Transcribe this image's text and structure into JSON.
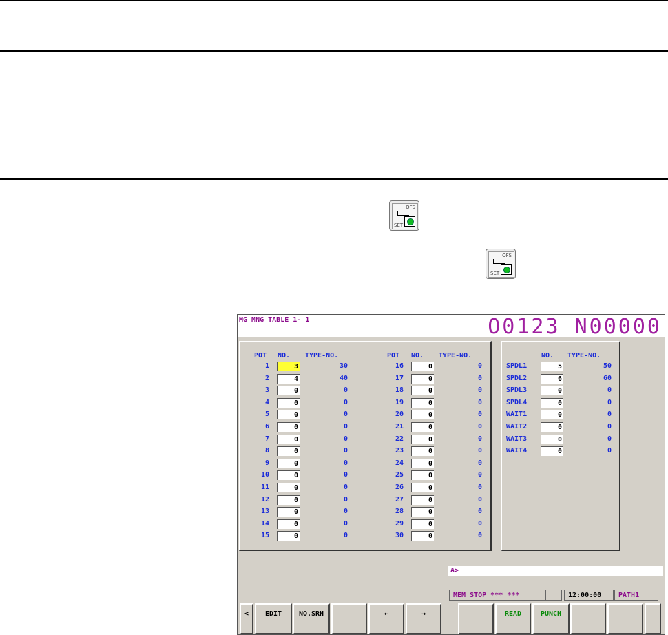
{
  "icons": [
    "ofs-set-key-icon",
    "ofs-set-key-icon"
  ],
  "screen": {
    "title": "MG MNG TABLE 1-   1",
    "program": "O0123 N00000",
    "left_headers": [
      "POT",
      "NO.",
      "TYPE-NO.",
      "POT",
      "NO.",
      "TYPE-NO."
    ],
    "pots_a": [
      {
        "pot": "1",
        "no": "3",
        "type": "30"
      },
      {
        "pot": "2",
        "no": "4",
        "type": "40"
      },
      {
        "pot": "3",
        "no": "0",
        "type": "0"
      },
      {
        "pot": "4",
        "no": "0",
        "type": "0"
      },
      {
        "pot": "5",
        "no": "0",
        "type": "0"
      },
      {
        "pot": "6",
        "no": "0",
        "type": "0"
      },
      {
        "pot": "7",
        "no": "0",
        "type": "0"
      },
      {
        "pot": "8",
        "no": "0",
        "type": "0"
      },
      {
        "pot": "9",
        "no": "0",
        "type": "0"
      },
      {
        "pot": "10",
        "no": "0",
        "type": "0"
      },
      {
        "pot": "11",
        "no": "0",
        "type": "0"
      },
      {
        "pot": "12",
        "no": "0",
        "type": "0"
      },
      {
        "pot": "13",
        "no": "0",
        "type": "0"
      },
      {
        "pot": "14",
        "no": "0",
        "type": "0"
      },
      {
        "pot": "15",
        "no": "0",
        "type": "0"
      }
    ],
    "pots_b": [
      {
        "pot": "16",
        "no": "0",
        "type": "0"
      },
      {
        "pot": "17",
        "no": "0",
        "type": "0"
      },
      {
        "pot": "18",
        "no": "0",
        "type": "0"
      },
      {
        "pot": "19",
        "no": "0",
        "type": "0"
      },
      {
        "pot": "20",
        "no": "0",
        "type": "0"
      },
      {
        "pot": "21",
        "no": "0",
        "type": "0"
      },
      {
        "pot": "22",
        "no": "0",
        "type": "0"
      },
      {
        "pot": "23",
        "no": "0",
        "type": "0"
      },
      {
        "pot": "24",
        "no": "0",
        "type": "0"
      },
      {
        "pot": "25",
        "no": "0",
        "type": "0"
      },
      {
        "pot": "26",
        "no": "0",
        "type": "0"
      },
      {
        "pot": "27",
        "no": "0",
        "type": "0"
      },
      {
        "pot": "28",
        "no": "0",
        "type": "0"
      },
      {
        "pot": "29",
        "no": "0",
        "type": "0"
      },
      {
        "pot": "30",
        "no": "0",
        "type": "0"
      }
    ],
    "right_headers": [
      "NO.",
      "TYPE-NO."
    ],
    "spindles": [
      {
        "name": "SPDL1",
        "no": "5",
        "type": "50"
      },
      {
        "name": "SPDL2",
        "no": "6",
        "type": "60"
      },
      {
        "name": "SPDL3",
        "no": "0",
        "type": "0"
      },
      {
        "name": "SPDL4",
        "no": "0",
        "type": "0"
      },
      {
        "name": "WAIT1",
        "no": "0",
        "type": "0"
      },
      {
        "name": "WAIT2",
        "no": "0",
        "type": "0"
      },
      {
        "name": "WAIT3",
        "no": "0",
        "type": "0"
      },
      {
        "name": "WAIT4",
        "no": "0",
        "type": "0"
      }
    ],
    "input_prompt": "A>",
    "status": {
      "mode": "MEM  STOP *** ***",
      "time": "12:00:00",
      "path": "PATH1"
    },
    "softkeys": [
      "<",
      "EDIT",
      "NO.SRH",
      "",
      "←",
      "→",
      "",
      "READ",
      "PUNCH",
      "",
      "",
      ""
    ]
  },
  "colors": {
    "header_magenta": "#8b0a8b",
    "label_blue": "#1a2bd8",
    "selected_cell": "#ffff33",
    "softkey_green": "#0a8a0a"
  }
}
